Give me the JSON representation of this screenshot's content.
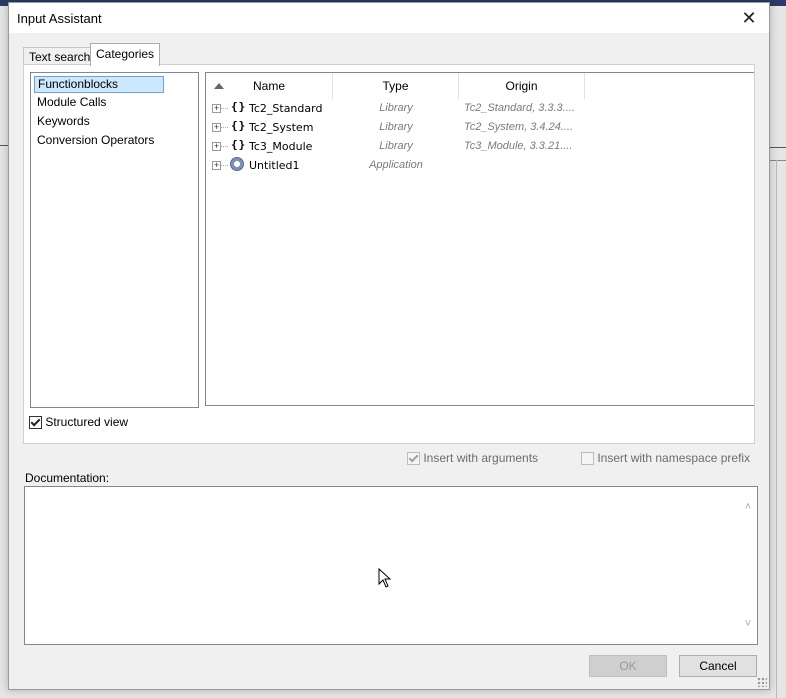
{
  "dialog": {
    "title": "Input Assistant",
    "close_glyph": "✕"
  },
  "tabs": [
    {
      "label": "Text search",
      "active": false
    },
    {
      "label": "Categories",
      "active": true
    }
  ],
  "categories": {
    "items": [
      {
        "label": "Functionblocks",
        "selected": true
      },
      {
        "label": "Module Calls",
        "selected": false
      },
      {
        "label": "Keywords",
        "selected": false
      },
      {
        "label": "Conversion Operators",
        "selected": false
      }
    ]
  },
  "tree": {
    "columns": {
      "name": "Name",
      "type": "Type",
      "origin": "Origin"
    },
    "sort": "ascending",
    "rows": [
      {
        "name": "Tc2_Standard",
        "type": "Library",
        "origin": "Tc2_Standard, 3.3.3....",
        "icon": "library-braces-icon",
        "expander": "+"
      },
      {
        "name": "Tc2_System",
        "type": "Library",
        "origin": "Tc2_System, 3.4.24....",
        "icon": "library-braces-icon",
        "expander": "+"
      },
      {
        "name": "Tc3_Module",
        "type": "Library",
        "origin": "Tc3_Module, 3.3.21....",
        "icon": "library-braces-icon",
        "expander": "+"
      },
      {
        "name": "Untitled1",
        "type": "Application",
        "origin": "",
        "icon": "application-gear-icon",
        "expander": "+"
      }
    ],
    "library_icon_glyph": "{}"
  },
  "options": {
    "structured_view": {
      "label": "Structured view",
      "checked": true
    },
    "insert_with_arguments": {
      "label": "Insert with arguments",
      "checked": true,
      "enabled": false
    },
    "insert_with_namespace_prefix": {
      "label": "Insert with namespace prefix",
      "checked": false,
      "enabled": false
    }
  },
  "documentation": {
    "label": "Documentation:",
    "content": ""
  },
  "buttons": {
    "ok": {
      "label": "OK",
      "enabled": false
    },
    "cancel": {
      "label": "Cancel",
      "enabled": true
    }
  },
  "colors": {
    "selection_bg": "#cce8ff",
    "selection_border": "#6f9fe6",
    "italic_gray": "#7a7a7a"
  }
}
